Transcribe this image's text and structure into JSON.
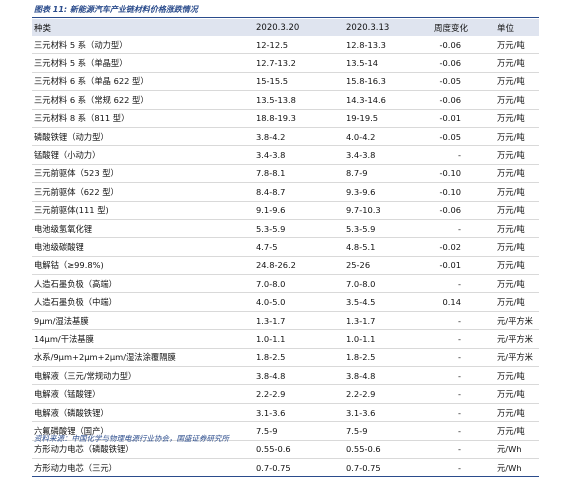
{
  "title": "图表 11: 新能源汽车产业链材料价格涨跌情况",
  "headers": [
    "种类",
    "2020.3.20",
    "2020.3.13",
    "周度变化",
    "单位"
  ],
  "rows": [
    [
      "三元材料 5 系（动力型）",
      "12-12.5",
      "12.8-13.3",
      "-0.06",
      "万元/吨"
    ],
    [
      "三元材料 5 系（单晶型）",
      "12.7-13.2",
      "13.5-14",
      "-0.06",
      "万元/吨"
    ],
    [
      "三元材料 6 系（单晶 622 型）",
      "15-15.5",
      "15.8-16.3",
      "-0.05",
      "万元/吨"
    ],
    [
      "三元材料 6 系（常规 622 型）",
      "13.5-13.8",
      "14.3-14.6",
      "-0.06",
      "万元/吨"
    ],
    [
      "三元材料 8 系（811 型）",
      "18.8-19.3",
      "19-19.5",
      "-0.01",
      "万元/吨"
    ],
    [
      "磷酸铁锂（动力型）",
      "3.8-4.2",
      "4.0-4.2",
      "-0.05",
      "万元/吨"
    ],
    [
      "锰酸锂（小动力）",
      "3.4-3.8",
      "3.4-3.8",
      "-",
      "万元/吨"
    ],
    [
      "三元前驱体（523 型）",
      "7.8-8.1",
      "8.7-9",
      "-0.10",
      "万元/吨"
    ],
    [
      "三元前驱体（622 型）",
      "8.4-8.7",
      "9.3-9.6",
      "-0.10",
      "万元/吨"
    ],
    [
      "三元前驱体(111 型)",
      "9.1-9.6",
      "9.7-10.3",
      "-0.06",
      "万元/吨"
    ],
    [
      "电池级氢氧化锂",
      "5.3-5.9",
      "5.3-5.9",
      "-",
      "万元/吨"
    ],
    [
      "电池级碳酸锂",
      "4.7-5",
      "4.8-5.1",
      "-0.02",
      "万元/吨"
    ],
    [
      "电解钴（≥99.8%)",
      "24.8-26.2",
      "25-26",
      "-0.01",
      "万元/吨"
    ],
    [
      "人造石墨负极（高端）",
      "7.0-8.0",
      "7.0-8.0",
      "-",
      "万元/吨"
    ],
    [
      "人造石墨负极（中端）",
      "4.0-5.0",
      "3.5-4.5",
      "0.14",
      "万元/吨"
    ],
    [
      "9μm/湿法基膜",
      "1.3-1.7",
      "1.3-1.7",
      "-",
      "元/平方米"
    ],
    [
      "14μm/干法基膜",
      "1.0-1.1",
      "1.0-1.1",
      "-",
      "元/平方米"
    ],
    [
      "水系/9μm+2μm+2μm/湿法涂覆隔膜",
      "1.8-2.5",
      "1.8-2.5",
      "-",
      "元/平方米"
    ],
    [
      "电解液（三元/常规动力型）",
      "3.8-4.8",
      "3.8-4.8",
      "-",
      "万元/吨"
    ],
    [
      "电解液（锰酸锂）",
      "2.2-2.9",
      "2.2-2.9",
      "-",
      "万元/吨"
    ],
    [
      "电解液（磷酸铁锂）",
      "3.1-3.6",
      "3.1-3.6",
      "-",
      "万元/吨"
    ],
    [
      "六氟磷酸锂（国产）",
      "7.5-9",
      "7.5-9",
      "-",
      "万元/吨"
    ],
    [
      "方形动力电芯（磷酸铁锂）",
      "0.55-0.6",
      "0.55-0.6",
      "-",
      "元/Wh"
    ],
    [
      "方形动力电芯（三元）",
      "0.7-0.75",
      "0.7-0.75",
      "-",
      "元/Wh"
    ]
  ],
  "source": "资料来源：中国化学与物理电源行业协会，国盛证券研究所"
}
